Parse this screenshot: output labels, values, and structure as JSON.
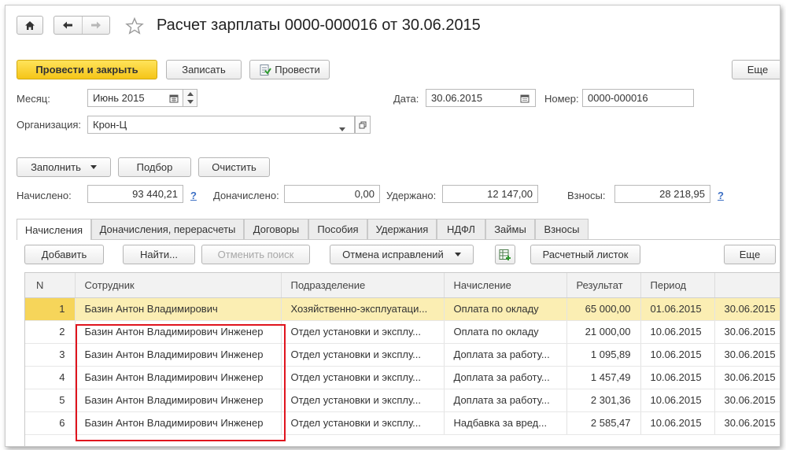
{
  "window": {
    "title": "Расчет зарплаты 0000-000016 от 30.06.2015",
    "more_label": "Еще"
  },
  "toolbar": {
    "post_close": "Провести и закрыть",
    "save": "Записать",
    "post": "Провести"
  },
  "header": {
    "month_label": "Месяц:",
    "month_value": "Июнь 2015",
    "date_label": "Дата:",
    "date_value": "30.06.2015",
    "number_label": "Номер:",
    "number_value": "0000-000016",
    "org_label": "Организация:",
    "org_value": "Крон-Ц"
  },
  "actions": {
    "fill": "Заполнить",
    "select": "Подбор",
    "clear": "Очистить"
  },
  "totals": {
    "accrued_label": "Начислено:",
    "accrued_value": "93 440,21",
    "extra_label": "Доначислено:",
    "extra_value": "0,00",
    "withheld_label": "Удержано:",
    "withheld_value": "12 147,00",
    "contrib_label": "Взносы:",
    "contrib_value": "28 218,95",
    "help": "?"
  },
  "tabs": [
    "Начисления",
    "Доначисления, перерасчеты",
    "Договоры",
    "Пособия",
    "Удержания",
    "НДФЛ",
    "Займы",
    "Взносы"
  ],
  "grid_toolbar": {
    "add": "Добавить",
    "find": "Найти...",
    "cancel_search": "Отменить поиск",
    "cancel_fixes": "Отмена исправлений",
    "payslip": "Расчетный листок",
    "more": "Еще"
  },
  "table": {
    "columns": [
      "N",
      "Сотрудник",
      "Подразделение",
      "Начисление",
      "Результат",
      "Период",
      ""
    ],
    "rows": [
      [
        "1",
        "Базин Антон Владимирович",
        "Хозяйственно-эксплуатаци...",
        "Оплата по окладу",
        "65 000,00",
        "01.06.2015",
        "30.06.2015"
      ],
      [
        "2",
        "Базин Антон Владимирович Инженер",
        "Отдел установки и эксплу...",
        "Оплата по окладу",
        "21 000,00",
        "10.06.2015",
        "30.06.2015"
      ],
      [
        "3",
        "Базин Антон Владимирович Инженер",
        "Отдел установки и эксплу...",
        "Доплата за работу...",
        "1 095,89",
        "10.06.2015",
        "30.06.2015"
      ],
      [
        "4",
        "Базин Антон Владимирович Инженер",
        "Отдел установки и эксплу...",
        "Доплата за работу...",
        "1 457,49",
        "10.06.2015",
        "30.06.2015"
      ],
      [
        "5",
        "Базин Антон Владимирович Инженер",
        "Отдел установки и эксплу...",
        "Доплата за работу...",
        "2 301,36",
        "10.06.2015",
        "30.06.2015"
      ],
      [
        "6",
        "Базин Антон Владимирович Инженер",
        "Отдел установки и эксплу...",
        "Надбавка за вред...",
        "2 585,47",
        "10.06.2015",
        "30.06.2015"
      ]
    ]
  }
}
